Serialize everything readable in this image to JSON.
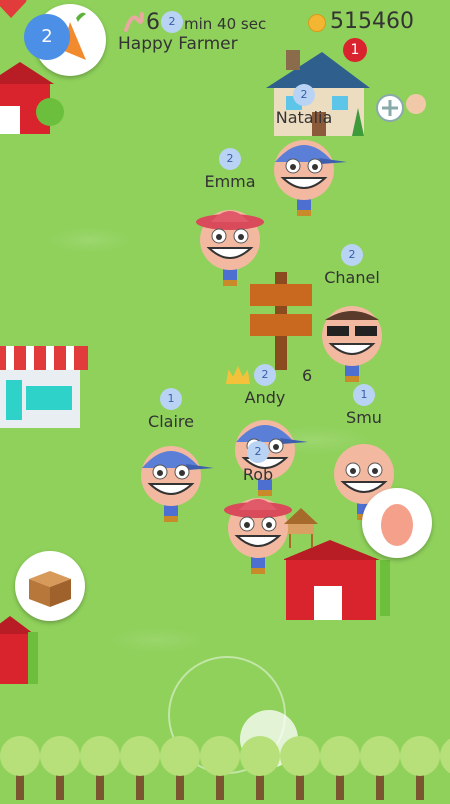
{
  "hud": {
    "player_level": "2",
    "player_name": "Happy Farmer",
    "worm_count": "6",
    "timer_text": "min 40 sec",
    "coins": "515460",
    "house_badge": "1",
    "timer_badge": "2"
  },
  "players": [
    {
      "name": "Natalia",
      "level": "2"
    },
    {
      "name": "Emma",
      "level": "2"
    },
    {
      "name": "Chanel",
      "level": "2"
    },
    {
      "name": "Andy",
      "level": "2"
    },
    {
      "name": "Claire",
      "level": "1"
    },
    {
      "name": "Smu",
      "level": "1"
    },
    {
      "name": "Rob",
      "level": "2"
    }
  ],
  "signpost_count": "6",
  "icons": [
    "heart-icon",
    "carrot-icon",
    "worm-icon",
    "coin-icon",
    "add-friend-icon",
    "crate-icon",
    "egg-icon",
    "shop-icon",
    "barn-icon",
    "house-icon",
    "signpost-icon",
    "joystick-icon"
  ],
  "colors": {
    "grass": "#8fd15b",
    "barn": "#d9232d",
    "badge": "#d9232d",
    "level_bubble": "#b9d3f5"
  }
}
